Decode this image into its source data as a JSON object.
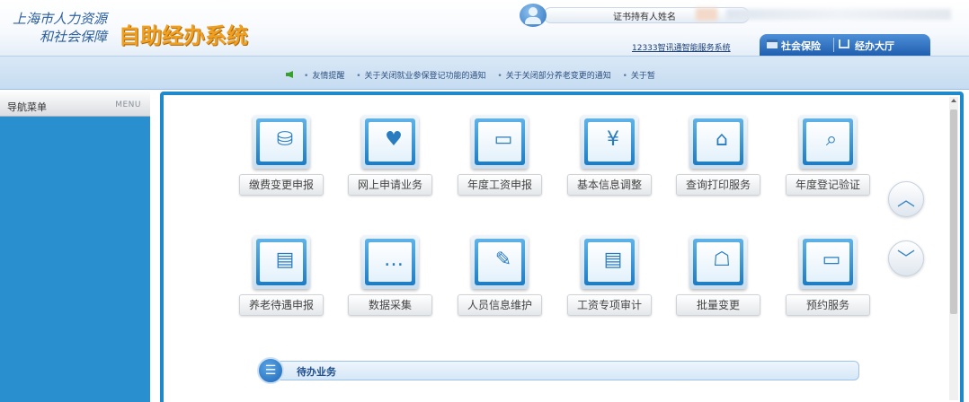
{
  "header": {
    "logo_line1": "上海市人力资源",
    "logo_line2": "和社会保障",
    "system_name": "自助经办系统",
    "user_label": "证书持有人姓名",
    "service_link": "12333智讯通智能服务系统",
    "tabs": [
      {
        "label": "社会保险",
        "icon": "social-insurance-icon"
      },
      {
        "label": "经办大厅",
        "icon": "hall-icon"
      }
    ]
  },
  "notice": {
    "items": [
      "友情提醒",
      "关于关闭就业参保登记功能的通知",
      "关于关闭部分养老变更的通知",
      "关于暂"
    ]
  },
  "sidebar": {
    "title": "导航菜单",
    "menu_label": "MENU"
  },
  "tiles": [
    {
      "label": "缴费变更申报",
      "icon": "payment-change-icon"
    },
    {
      "label": "网上申请业务",
      "icon": "online-application-icon"
    },
    {
      "label": "年度工资申报",
      "icon": "monitor-icon"
    },
    {
      "label": "基本信息调整",
      "icon": "info-adjust-icon"
    },
    {
      "label": "查询打印服务",
      "icon": "home-icon"
    },
    {
      "label": "年度登记验证",
      "icon": "document-search-icon"
    },
    {
      "label": "养老待遇申报",
      "icon": "printer-icon"
    },
    {
      "label": "数据采集",
      "icon": "chat-icon"
    },
    {
      "label": "人员信息维护",
      "icon": "edit-document-icon"
    },
    {
      "label": "工资专项审计",
      "icon": "printer-icon"
    },
    {
      "label": "批量变更",
      "icon": "presentation-icon"
    },
    {
      "label": "预约服务",
      "icon": "monitor-icon"
    }
  ],
  "nav_buttons": {
    "up_glyph": "︿",
    "down_glyph": "﹀"
  },
  "pending": {
    "label": "待办业务"
  },
  "colors": {
    "accent_blue": "#1f8acb",
    "logo_orange": "#f0a020"
  }
}
